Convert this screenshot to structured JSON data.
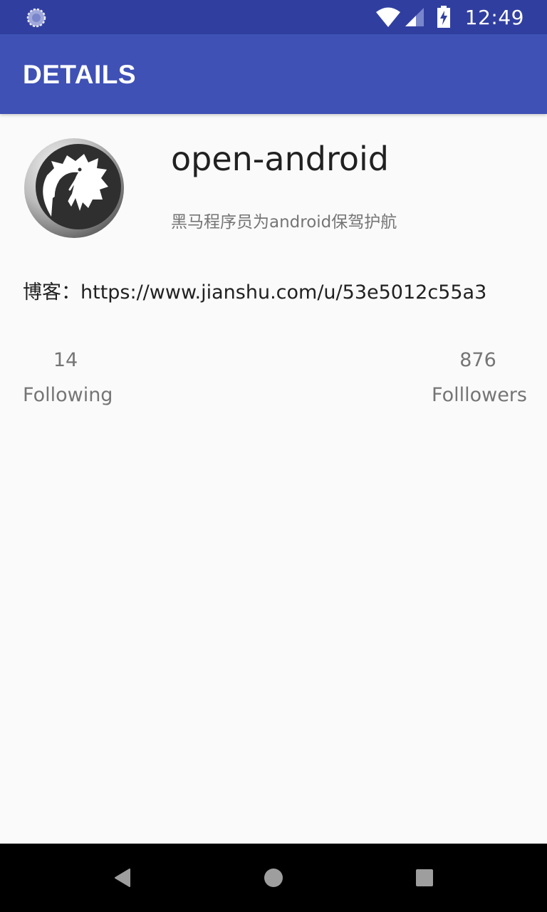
{
  "status_bar": {
    "time": "12:49"
  },
  "app_bar": {
    "title": "DETAILS"
  },
  "profile": {
    "name": "open-android",
    "description": "黑马程序员为android保驾护航",
    "blog_label": "博客：",
    "blog_url": "https://www.jianshu.com/u/53e5012c55a3"
  },
  "stats": {
    "following_count": "14",
    "following_label": "Following",
    "followers_count": "876",
    "followers_label": "Folllowers"
  },
  "colors": {
    "status_bar": "#303f9f",
    "app_bar": "#3f51b5",
    "background": "#fafafa",
    "primary_text": "#212121",
    "secondary_text": "#757575"
  },
  "icons": {
    "status_left": "loading-icon",
    "wifi": "wifi-icon",
    "signal": "signal-icon",
    "battery": "battery-charging-icon",
    "avatar": "dragon-logo-icon",
    "nav_back": "back-triangle-icon",
    "nav_home": "home-circle-icon",
    "nav_recents": "recents-square-icon"
  }
}
